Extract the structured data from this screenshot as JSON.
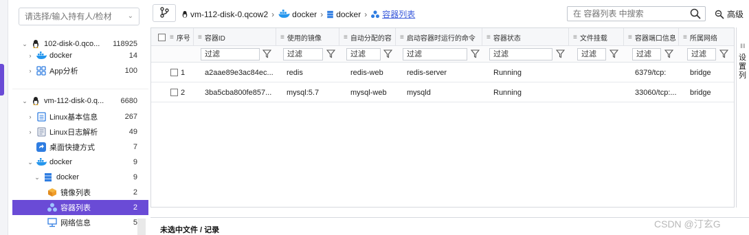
{
  "sidebar": {
    "search_placeholder": "请选择/输入持有人/检材",
    "tree": [
      {
        "label": "102-disk-0.qco...",
        "count": "118925",
        "icon": "linux-penguin-icon",
        "arrow": "down"
      },
      {
        "label": "docker",
        "count": "14",
        "icon": "docker-whale-icon",
        "arrow": "right"
      },
      {
        "label": "App分析",
        "count": "100",
        "icon": "app-grid-icon",
        "arrow": "right"
      },
      {
        "label": "vm-112-disk-0.q...",
        "count": "6680",
        "icon": "linux-penguin-icon",
        "arrow": "down"
      },
      {
        "label": "Linux基本信息",
        "count": "267",
        "icon": "info-doc-icon",
        "arrow": "right"
      },
      {
        "label": "Linux日志解析",
        "count": "49",
        "icon": "log-doc-icon",
        "arrow": "right"
      },
      {
        "label": "桌面快捷方式",
        "count": "7",
        "icon": "shortcut-icon",
        "arrow": ""
      },
      {
        "label": "docker",
        "count": "9",
        "icon": "docker-whale-icon",
        "arrow": "down"
      },
      {
        "label": "docker",
        "count": "9",
        "icon": "server-stack-icon",
        "arrow": "down"
      },
      {
        "label": "镜像列表",
        "count": "2",
        "icon": "image-cube-icon",
        "arrow": ""
      },
      {
        "label": "容器列表",
        "count": "2",
        "icon": "container-icon",
        "arrow": "",
        "selected": true
      },
      {
        "label": "网络信息",
        "count": "5",
        "icon": "network-icon",
        "arrow": ""
      }
    ]
  },
  "toolbar": {
    "breadcrumbs": [
      "vm-112-disk-0.qcow2",
      "docker",
      "docker",
      "容器列表"
    ],
    "search_placeholder": "在 容器列表 中搜索",
    "advanced_label": "高级"
  },
  "grid": {
    "columns": [
      "序号",
      "容器ID",
      "使用的镜像",
      "自动分配的容",
      "启动容器时运行的命令",
      "容器状态",
      "文件挂载",
      "容器端口信息",
      "所属网络"
    ],
    "filter_placeholder": "过滤",
    "rows": [
      {
        "index": "1",
        "id": "a2aae89e3ac84ec...",
        "image": "redis",
        "name": "redis-web",
        "command": "redis-server",
        "status": "Running",
        "mount": "",
        "ports": "6379/tcp:",
        "network": "bridge"
      },
      {
        "index": "2",
        "id": "3ba5cba800fe857...",
        "image": "mysql:5.7",
        "name": "mysql-web",
        "command": "mysqld",
        "status": "Running",
        "mount": "",
        "ports": "33060/tcp:...",
        "network": "bridge"
      }
    ]
  },
  "side_panel": {
    "label": "设置列"
  },
  "bottom": {
    "label": "未选中文件 / 记录"
  },
  "watermark": "CSDN @汀玄G",
  "colors": {
    "accent": "#6a4bd6",
    "link": "#3b5bdb",
    "docker_blue": "#2496ed"
  }
}
